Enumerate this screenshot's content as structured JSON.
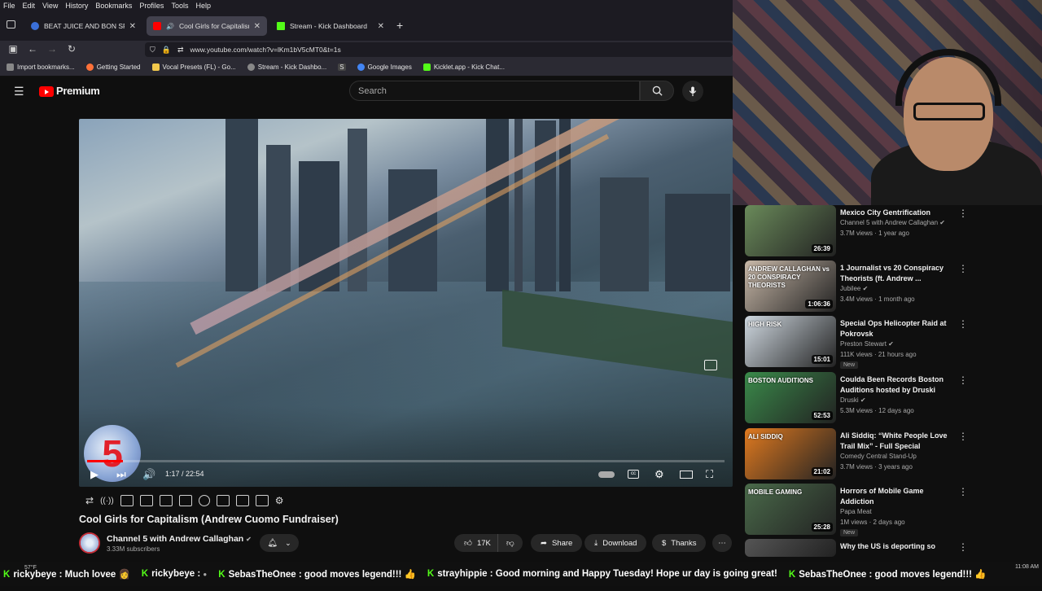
{
  "menu": [
    "File",
    "Edit",
    "View",
    "History",
    "Bookmarks",
    "Profiles",
    "Tools",
    "Help"
  ],
  "tabs": [
    {
      "label": "BEAT JUICE AND BON SPLIFF - I",
      "active": false,
      "favicon_color": "#3a6fd8"
    },
    {
      "label": "Cool Girls for Capitalism (A",
      "active": true,
      "favicon_color": "#ff0000"
    },
    {
      "label": "Stream - Kick Dashboard",
      "active": false,
      "favicon_color": "#53fc18"
    }
  ],
  "url": "www.youtube.com/watch?v=lKm1bV5cMT0&t=1s",
  "bookmarks": [
    {
      "label": "Import bookmarks...",
      "color": "#aaa"
    },
    {
      "label": "Getting Started",
      "color": "#ff7139"
    },
    {
      "label": "Vocal Presets (FL) - Go...",
      "color": "#f2c94c"
    },
    {
      "label": "Stream - Kick Dashbo...",
      "color": "#888"
    },
    {
      "label": "S",
      "color": "#888"
    },
    {
      "label": "Google Images",
      "color": "#4285f4"
    },
    {
      "label": "Kicklet.app - Kick Chat...",
      "color": "#53fc18"
    }
  ],
  "youtube": {
    "logo_text": "Premium",
    "search_placeholder": "Search"
  },
  "player": {
    "time": "1:17 / 22:54",
    "progress_fraction": 0.056,
    "channel_logo_text": "5"
  },
  "video": {
    "title": "Cool Girls for Capitalism (Andrew Cuomo Fundraiser)",
    "channel": "Channel 5 with Andrew Callaghan",
    "subscribers": "3.33M subscribers",
    "likes": "17K",
    "share_label": "Share",
    "download_label": "Download",
    "thanks_label": "Thanks"
  },
  "recommendations": [
    {
      "title": "Mexico City Gentrification",
      "channel": "Channel 5 with Andrew Callaghan",
      "verified": true,
      "meta": "3.7M views · 1 year ago",
      "duration": "26:39",
      "new": false,
      "thumb_color": "#6a8a5a"
    },
    {
      "title": "1 Journalist vs 20 Conspiracy Theorists (ft. Andrew ...",
      "channel": "Jubilee",
      "verified": true,
      "meta": "3.4M views · 1 month ago",
      "duration": "1:06:36",
      "new": false,
      "thumb_color": "#c8b8a8",
      "thumb_text": "ANDREW CALLAGHAN vs 20 CONSPIRACY THEORISTS"
    },
    {
      "title": "Special Ops Helicopter Raid at Pokrovsk",
      "channel": "Preston Stewart",
      "verified": true,
      "meta": "111K views · 21 hours ago",
      "duration": "15:01",
      "new": true,
      "new_label": "New",
      "thumb_color": "#cfd8e0",
      "thumb_text": "HIGH RISK"
    },
    {
      "title": "Coulda Been Records Boston Auditions hosted by Druski",
      "channel": "Druski",
      "verified": true,
      "meta": "5.3M views · 12 days ago",
      "duration": "52:53",
      "new": false,
      "thumb_color": "#3a8a4a",
      "thumb_text": "BOSTON AUDITIONS"
    },
    {
      "title": "Ali Siddiq: “White People Love Trail Mix” - Full Special",
      "channel": "Comedy Central Stand-Up",
      "verified": false,
      "meta": "3.7M views · 3 years ago",
      "duration": "21:02",
      "new": false,
      "thumb_color": "#e07a20",
      "thumb_text": "ALI SIDDIQ"
    },
    {
      "title": "Horrors of Mobile Game Addiction",
      "channel": "Papa Meat",
      "verified": false,
      "meta": "1M views · 2 days ago",
      "duration": "25:28",
      "new": true,
      "new_label": "New",
      "thumb_color": "#4a6a4a",
      "thumb_text": "MOBILE GAMING"
    },
    {
      "title": "Why the US is deporting so",
      "channel": "",
      "verified": false,
      "meta": "",
      "duration": "",
      "new": false,
      "thumb_color": "#555"
    }
  ],
  "chat": [
    {
      "user": "rickybeye",
      "msg": "Much lovee"
    },
    {
      "user": "rickybeye",
      "msg": ""
    },
    {
      "user": "SebasTheOnee",
      "msg": "good moves legend!!!"
    },
    {
      "user": "strayhippie",
      "msg": "Good morning and Happy Tuesday! Hope ur day is going great!"
    },
    {
      "user": "SebasTheOnee",
      "msg": "good moves legend!!!"
    }
  ],
  "system_tray": {
    "temp": "57°F",
    "time": "11:08 AM"
  }
}
